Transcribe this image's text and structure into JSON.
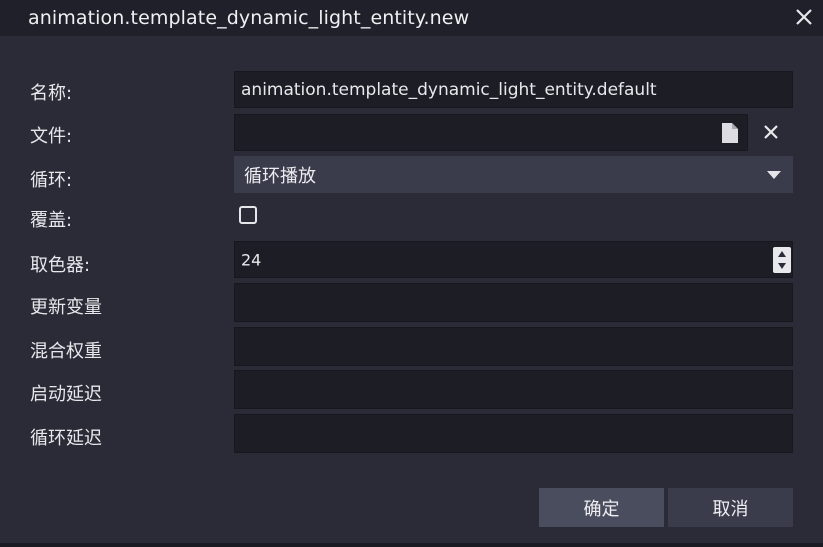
{
  "window": {
    "title": "animation.template_dynamic_light_entity.new"
  },
  "form": {
    "name_label": "名称:",
    "name_value": "animation.template_dynamic_light_entity.default",
    "file_label": "文件:",
    "file_value": "",
    "loop_label": "循环:",
    "loop_value": "循环播放",
    "override_label": "覆盖:",
    "override_checked": false,
    "picker_label": "取色器:",
    "picker_value": "24",
    "update_vars_label": "更新变量",
    "blend_weight_label": "混合权重",
    "start_delay_label": "启动延迟",
    "loop_delay_label": "循环延迟"
  },
  "buttons": {
    "ok": "确定",
    "cancel": "取消"
  },
  "icons": {
    "close": "close-icon",
    "file": "file-icon",
    "clear": "clear-icon",
    "dropdown": "chevron-down-icon",
    "spinner": "spinner-icon"
  },
  "colors": {
    "background": "#2a2b36",
    "field": "#1d1e25",
    "select": "#3a3c4b",
    "button_primary": "#4a4d5e"
  }
}
